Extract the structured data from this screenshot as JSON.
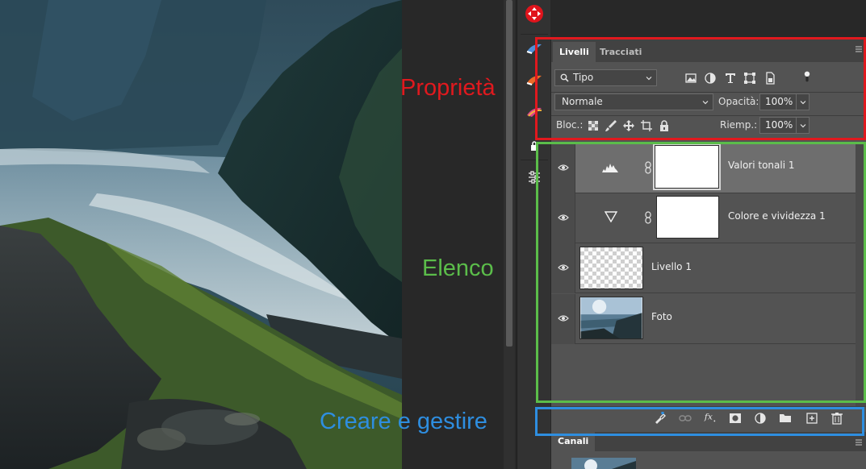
{
  "panel": {
    "tabs": [
      {
        "label": "Livelli",
        "active": true
      },
      {
        "label": "Tracciati",
        "active": false
      }
    ],
    "filter": {
      "value": "Tipo"
    },
    "blend_mode": {
      "value": "Normale"
    },
    "opacity": {
      "label": "Opacità:",
      "value": "100%"
    },
    "lock": {
      "label": "Bloc.:"
    },
    "fill": {
      "label": "Riemp.:",
      "value": "100%"
    },
    "layers": [
      {
        "name": "Valori tonali 1",
        "kind": "adjustment-levels",
        "selected": true,
        "visible": true
      },
      {
        "name": "Colore e vividezza 1",
        "kind": "adjustment-vibrance",
        "selected": false,
        "visible": true
      },
      {
        "name": "Livello 1",
        "kind": "transparent-pixel",
        "selected": false,
        "visible": true
      },
      {
        "name": "Foto",
        "kind": "photo",
        "selected": false,
        "visible": true
      }
    ],
    "channels_tab": {
      "label": "Canali"
    }
  },
  "annotations": {
    "properties": {
      "label": "Proprietà",
      "color": "#e0191e"
    },
    "list": {
      "label": "Elenco",
      "color": "#5bbd4a"
    },
    "manage": {
      "label": "Creare e gestire",
      "color": "#2e8ee0"
    }
  },
  "colors": {
    "panel_bg": "#535353",
    "tab_bg": "#424242",
    "selected_row": "#6e6e6e"
  }
}
